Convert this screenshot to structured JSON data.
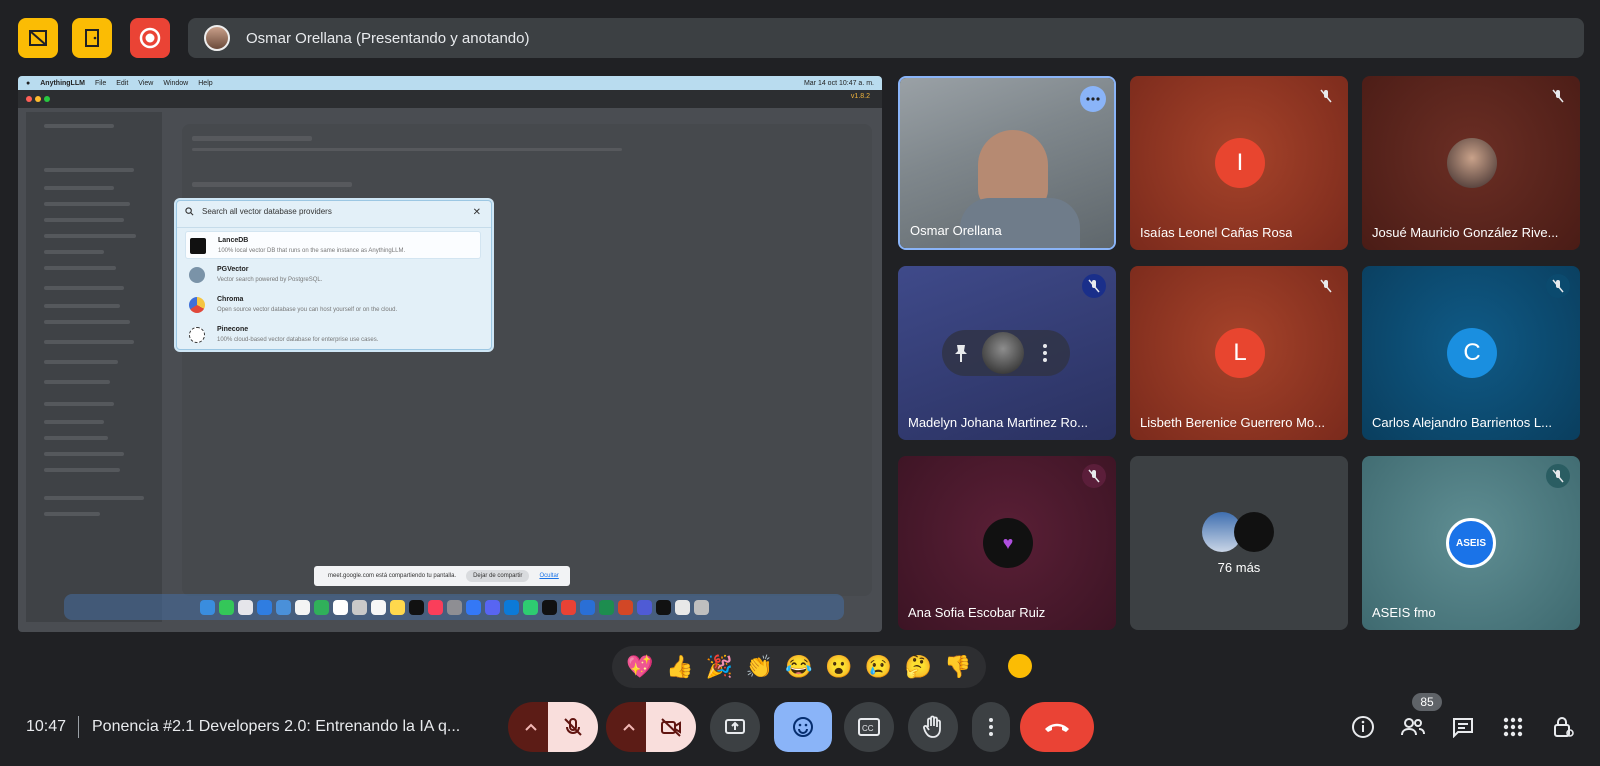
{
  "presenter_bar": {
    "name": "Osmar Orellana (Presentando y anotando)"
  },
  "shared_screen": {
    "menubar": {
      "app": "AnythingLLM",
      "items": [
        "File",
        "Edit",
        "View",
        "Window",
        "Help"
      ],
      "clock": "Mar 14 oct  10:47 a. m."
    },
    "version": "v1.8.2",
    "modal": {
      "search_placeholder": "Search all vector database providers",
      "providers": [
        {
          "name": "LanceDB",
          "desc": "100% local vector DB that runs on the same instance as AnythingLLM."
        },
        {
          "name": "PGVector",
          "desc": "Vector search powered by PostgreSQL."
        },
        {
          "name": "Chroma",
          "desc": "Open source vector database you can host yourself or on the cloud."
        },
        {
          "name": "Pinecone",
          "desc": "100% cloud-based vector database for enterprise use cases."
        }
      ]
    },
    "share_notice": {
      "text": "meet.google.com está compartiendo tu pantalla.",
      "stop": "Dejar de compartir",
      "hide": "Ocultar"
    }
  },
  "participants": [
    {
      "name": "Osmar Orellana"
    },
    {
      "name": "Isaías Leonel Cañas Rosa",
      "initial": "I"
    },
    {
      "name": "Josué Mauricio González Rive..."
    },
    {
      "name": "Madelyn Johana Martinez Ro..."
    },
    {
      "name": "Lisbeth Berenice Guerrero Mo...",
      "initial": "L"
    },
    {
      "name": "Carlos Alejandro Barrientos L...",
      "initial": "C"
    },
    {
      "name": "Ana Sofia Escobar Ruiz"
    },
    {
      "name": "76 más"
    },
    {
      "name": "ASEIS fmo",
      "logo_text": "ASEIS"
    }
  ],
  "reactions": [
    "💖",
    "👍",
    "🎉",
    "👏",
    "😂",
    "😮",
    "😢",
    "🤔",
    "👎"
  ],
  "bottom": {
    "time": "10:47",
    "meeting_title": "Ponencia #2.1 Developers 2.0: Entrenando la IA q...",
    "people_count": "85"
  },
  "colors": {
    "accent_blue": "#8ab4f8",
    "hangup_red": "#ea4335",
    "top_yellow": "#fbbc04"
  }
}
